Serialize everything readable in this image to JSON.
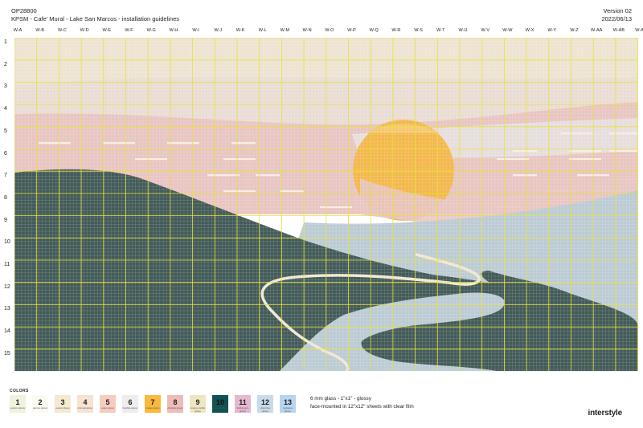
{
  "header": {
    "project_id": "OP28800",
    "project_title": "KPSM - Cafe' Mural - Lake San Marcos - installation guidelines",
    "version": "Version 02",
    "date": "2022/06/13"
  },
  "grid": {
    "columns": [
      "W-A",
      "W-B",
      "W-C",
      "W-D",
      "W-E",
      "W-F",
      "W-G",
      "W-H",
      "W-I",
      "W-J",
      "W-K",
      "W-L",
      "W-M",
      "W-N",
      "W-O",
      "W-P",
      "W-Q",
      "W-R",
      "W-S",
      "W-T",
      "W-U",
      "W-V",
      "W-W",
      "W-X",
      "W-Y",
      "W-Z",
      "W-AA",
      "W-AB",
      "W-AC"
    ],
    "rows": [
      "1",
      "2",
      "3",
      "4",
      "5",
      "6",
      "7",
      "8",
      "9",
      "10",
      "11",
      "12",
      "13",
      "14",
      "15"
    ]
  },
  "legend": {
    "title": "COLORS",
    "colors": [
      {
        "num": "1",
        "name": "popcorn",
        "finish": "glossy",
        "hex": "#eef3df"
      },
      {
        "num": "2",
        "name": "jasmine",
        "finish": "glossy",
        "hex": "#fbfbf3"
      },
      {
        "num": "3",
        "name": "peanut",
        "finish": "glossy",
        "hex": "#f4ead2"
      },
      {
        "num": "4",
        "name": "pink salt",
        "finish": "glossy",
        "hex": "#f7e3d2"
      },
      {
        "num": "5",
        "name": "oyster",
        "finish": "glossy",
        "hex": "#f5cdbf"
      },
      {
        "num": "6",
        "name": "frostbite",
        "finish": "glossy",
        "hex": "#eeecef"
      },
      {
        "num": "7",
        "name": "mango",
        "finish": "glossy",
        "hex": "#f8b93c"
      },
      {
        "num": "8",
        "name": "charlotte",
        "finish": "glossy",
        "hex": "#eebcb8"
      },
      {
        "num": "9",
        "name": "creamy vanilla",
        "finish": "glossy",
        "hex": "#eee6c2"
      },
      {
        "num": "10",
        "name": "dark teal",
        "finish": "glossy",
        "hex": "#105252"
      },
      {
        "num": "11",
        "name": "bubble gum",
        "finish": "glossy",
        "hex": "#e4b9cf"
      },
      {
        "num": "12",
        "name": "olive blue",
        "finish": "glossy",
        "hex": "#c9dbea"
      },
      {
        "num": "13",
        "name": "raybanos",
        "finish": "glossy",
        "hex": "#b8d5ef"
      }
    ]
  },
  "spec": {
    "line1": "6 mm glass - 1\"x1\" - glossy",
    "line2": "face-mounted in 12\"x12\" sheets with clear film"
  },
  "brand": "interstyle",
  "mural_palette": {
    "sky_top": "#ede3d1",
    "sky_mid": "#e9ddd3",
    "sky_pink": "#e8c5c1",
    "sky_light": "#e6dedd",
    "stripes": "#f7ede3",
    "sun": "#f3b84c",
    "sun_highlight": "#f6c86e",
    "hills": "#435b58",
    "water": "#bccbd3",
    "river_line": "#efe8cf",
    "grid_minor": "#ffffff",
    "grid_major": "#e8e23c"
  }
}
